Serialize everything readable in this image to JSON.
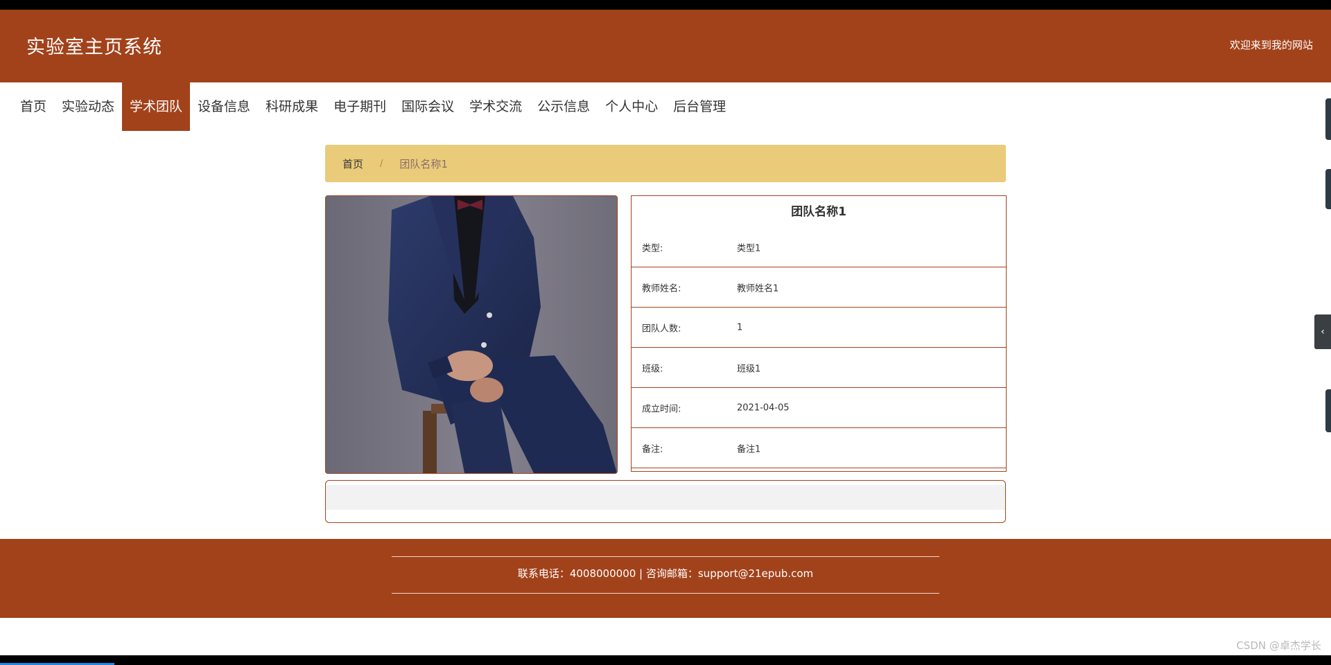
{
  "header": {
    "title": "实验室主页系统",
    "welcome": "欢迎来到我的网站"
  },
  "nav": {
    "items": [
      {
        "label": "首页"
      },
      {
        "label": "实验动态"
      },
      {
        "label": "学术团队"
      },
      {
        "label": "设备信息"
      },
      {
        "label": "科研成果"
      },
      {
        "label": "电子期刊"
      },
      {
        "label": "国际会议"
      },
      {
        "label": "学术交流"
      },
      {
        "label": "公示信息"
      },
      {
        "label": "个人中心"
      },
      {
        "label": "后台管理"
      }
    ],
    "active": "学术团队"
  },
  "breadcrumb": {
    "home": "首页",
    "separator": "/",
    "current": "团队名称1"
  },
  "detail": {
    "title": "团队名称1",
    "rows": [
      {
        "label": "类型:",
        "value": "类型1"
      },
      {
        "label": "教师姓名:",
        "value": "教师姓名1"
      },
      {
        "label": "团队人数:",
        "value": "1"
      },
      {
        "label": "班级:",
        "value": "班级1"
      },
      {
        "label": "成立时间:",
        "value": "2021-04-05"
      },
      {
        "label": "备注:",
        "value": "备注1"
      }
    ]
  },
  "footer": {
    "text": "联系电话：4008000000 | 咨询邮箱：support@21epub.com"
  },
  "watermark": "CSDN @卓杰学长",
  "icons": {
    "side_toggle": "chevron-left-icon"
  },
  "colors": {
    "brand": "#a2421b",
    "breadcrumb_bg": "#e9cb79"
  }
}
